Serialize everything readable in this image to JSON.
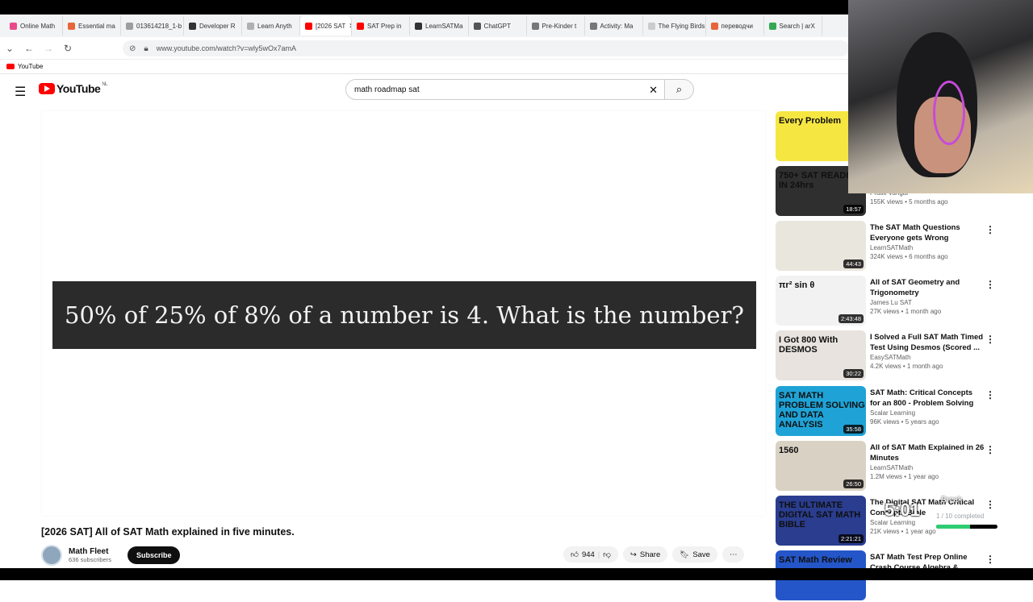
{
  "browser": {
    "tabs": [
      {
        "label": "Online Math",
        "color": "#e94b8a"
      },
      {
        "label": "Essential ma",
        "color": "#e8653a"
      },
      {
        "label": "013614218_1-b",
        "color": "#9e9e9e"
      },
      {
        "label": "Developer R",
        "color": "#333333"
      },
      {
        "label": "Learn Anyth",
        "color": "#b0b0b0"
      },
      {
        "label": "[2026 SAT",
        "color": "#ff0000",
        "active": true
      },
      {
        "label": "SAT Prep in",
        "color": "#ff0000"
      },
      {
        "label": "LearnSATMa",
        "color": "#333333"
      },
      {
        "label": "ChatGPT",
        "color": "#555555"
      },
      {
        "label": "Pre-Kinder t",
        "color": "#777777"
      },
      {
        "label": "Activity: Ma",
        "color": "#777777"
      },
      {
        "label": "The Flying Birds",
        "color": "#cccccc"
      },
      {
        "label": "переводчи",
        "color": "#e8653a"
      },
      {
        "label": "Search | arX",
        "color": "#34a853"
      }
    ],
    "url": "www.youtube.com/watch?v=wly5wOx7amA",
    "bookmark": "YouTube"
  },
  "youtube": {
    "logo_text": "YouTube",
    "region": "NL",
    "search_query": "math roadmap sat",
    "video": {
      "banner_text": "50% of 25% of 8% of a number is 4.  What is the number?",
      "title": "[2026 SAT] All of SAT Math explained in five minutes.",
      "channel": "Math Fleet",
      "subscribers": "636 subscribers",
      "subscribe_label": "Subscribe",
      "likes": "944",
      "share_label": "Share",
      "save_label": "Save"
    },
    "recommendations": [
      {
        "title": "",
        "channel": "",
        "views": "",
        "duration": "",
        "thumb_text": "Every Problem",
        "thumb_color": "#f5e642"
      },
      {
        "title": "",
        "channel": "Pratik Vangal",
        "views": "155K views • 5 months ago",
        "duration": "18:57",
        "thumb_text": "750+ SAT READING IN 24hrs",
        "thumb_color": "#2f2f2f"
      },
      {
        "title": "The SAT Math Questions Everyone gets Wrong",
        "channel": "LearnSATMath",
        "views": "324K views • 6 months ago",
        "duration": "44:43",
        "thumb_text": "",
        "thumb_color": "#e9e6dd"
      },
      {
        "title": "All of SAT Geometry and Trigonometry",
        "channel": "James Lu SAT",
        "views": "27K views • 1 month ago",
        "duration": "2:43:48",
        "thumb_text": "πr²  sin θ",
        "thumb_color": "#f2f2f2"
      },
      {
        "title": "I Solved a Full SAT Math Timed Test Using Desmos (Scored ...",
        "channel": "EasySATMath",
        "views": "4.2K views • 1 month ago",
        "duration": "30:22",
        "thumb_text": "I Got 800 With DESMOS",
        "thumb_color": "#e8e3de"
      },
      {
        "title": "SAT Math: Critical Concepts for an 800 - Problem Solving and ...",
        "channel": "Scalar Learning",
        "views": "96K views • 5 years ago",
        "duration": "35:58",
        "thumb_text": "SAT MATH PROBLEM SOLVING AND DATA ANALYSIS",
        "thumb_color": "#1fa3d6"
      },
      {
        "title": "All of SAT Math Explained in 26 Minutes",
        "channel": "LearnSATMath",
        "views": "1.2M views • 1 year ago",
        "duration": "26:50",
        "thumb_text": "1560",
        "thumb_color": "#d9d2c4"
      },
      {
        "title": "The Digital SAT Math Critical Concepts Bible",
        "channel": "Scalar Learning",
        "views": "21K views • 1 year ago",
        "duration": "2:21:21",
        "thumb_text": "THE ULTIMATE DIGITAL SAT MATH BIBLE",
        "thumb_color": "#2a3d8f"
      },
      {
        "title": "SAT Math Test Prep Online Crash Course Algebra &...",
        "channel": "",
        "views": "",
        "duration": "",
        "thumb_text": "SAT Math Review",
        "thumb_color": "#2456c9"
      }
    ]
  },
  "overlay": {
    "timer": "5:01",
    "timer_label": "Break",
    "progress_text": "1 / 10 completed",
    "progress_fraction": 0.55
  }
}
